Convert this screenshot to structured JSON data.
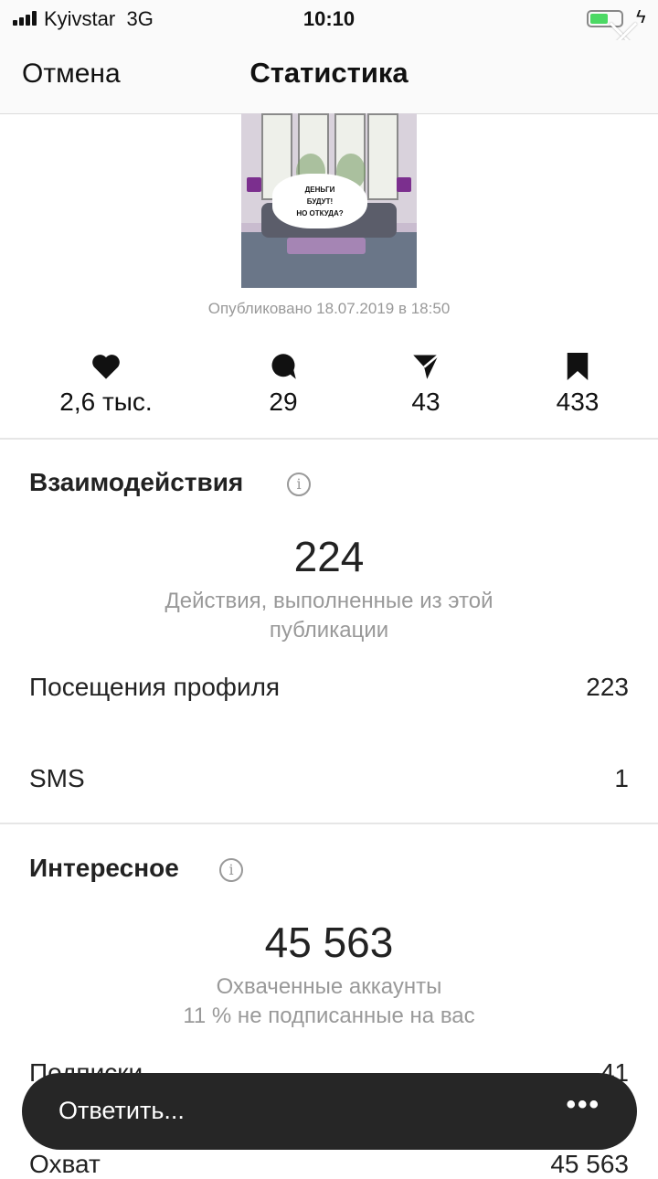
{
  "status_bar": {
    "carrier": "Kyivstar",
    "network": "3G",
    "time": "10:10",
    "battery_level": 0.6
  },
  "nav": {
    "cancel": "Отмена",
    "title": "Статистика"
  },
  "post": {
    "image_text": "ДЕНЬГИ\nБУДУТ!\nНО ОТКУДА?",
    "published": "Опубликовано 18.07.2019 в 18:50"
  },
  "metrics": {
    "likes": {
      "icon": "heart-icon",
      "value": "2,6 тыс."
    },
    "comments": {
      "icon": "comment-icon",
      "value": "29"
    },
    "shares": {
      "icon": "send-icon",
      "value": "43"
    },
    "saves": {
      "icon": "bookmark-icon",
      "value": "433"
    }
  },
  "interactions": {
    "title": "Взаимодействия",
    "total": "224",
    "caption": "Действия, выполненные из этой публикации",
    "rows": [
      {
        "label": "Посещения профиля",
        "value": "223"
      },
      {
        "label": "SMS",
        "value": "1"
      }
    ]
  },
  "discovery": {
    "title": "Интересное",
    "total": "45 563",
    "caption1": "Охваченные аккаунты",
    "caption2": "11 % не подписанные на вас",
    "rows": [
      {
        "label": "Подписки",
        "value": "41"
      },
      {
        "label": "Охват",
        "value": "45 563"
      }
    ]
  },
  "reply_bar": {
    "placeholder": "Ответить...",
    "more": "•••"
  }
}
